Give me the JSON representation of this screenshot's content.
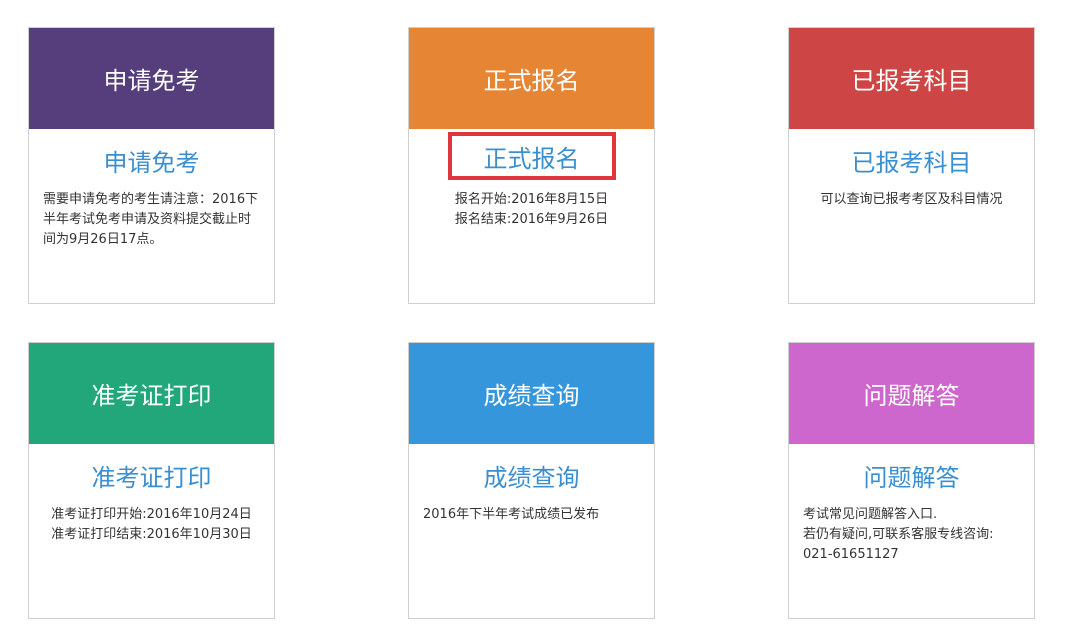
{
  "cards": [
    {
      "header": "申请免考",
      "link": "申请免考",
      "color": "#563d7c",
      "desc": [
        "需要申请免考的考生请注意：2016下半年考试免考申请及资料提交截止时间为9月26日17点。"
      ]
    },
    {
      "header": "正式报名",
      "link": "正式报名",
      "color": "#e68634",
      "desc": [
        "报名开始:2016年8月15日",
        "报名结束:2016年9月26日"
      ]
    },
    {
      "header": "已报考科目",
      "link": "已报考科目",
      "color": "#cd4545",
      "desc": [
        "可以查询已报考考区及科目情况"
      ]
    },
    {
      "header": "准考证打印",
      "link": "准考证打印",
      "color": "#22a77a",
      "desc": [
        "准考证打印开始:2016年10月24日",
        "准考证打印结束:2016年10月30日"
      ]
    },
    {
      "header": "成绩查询",
      "link": "成绩查询",
      "color": "#3596db",
      "desc": [
        "2016年下半年考试成绩已发布"
      ]
    },
    {
      "header": "问题解答",
      "link": "问题解答",
      "color": "#cd66cd",
      "desc": [
        "考试常见问题解答入口.",
        "若仍有疑问,可联系客服专线咨询:",
        "021-61651127"
      ]
    }
  ],
  "colors": {
    "link": "#3b8fd0",
    "highlight_border": "#e0353b"
  }
}
